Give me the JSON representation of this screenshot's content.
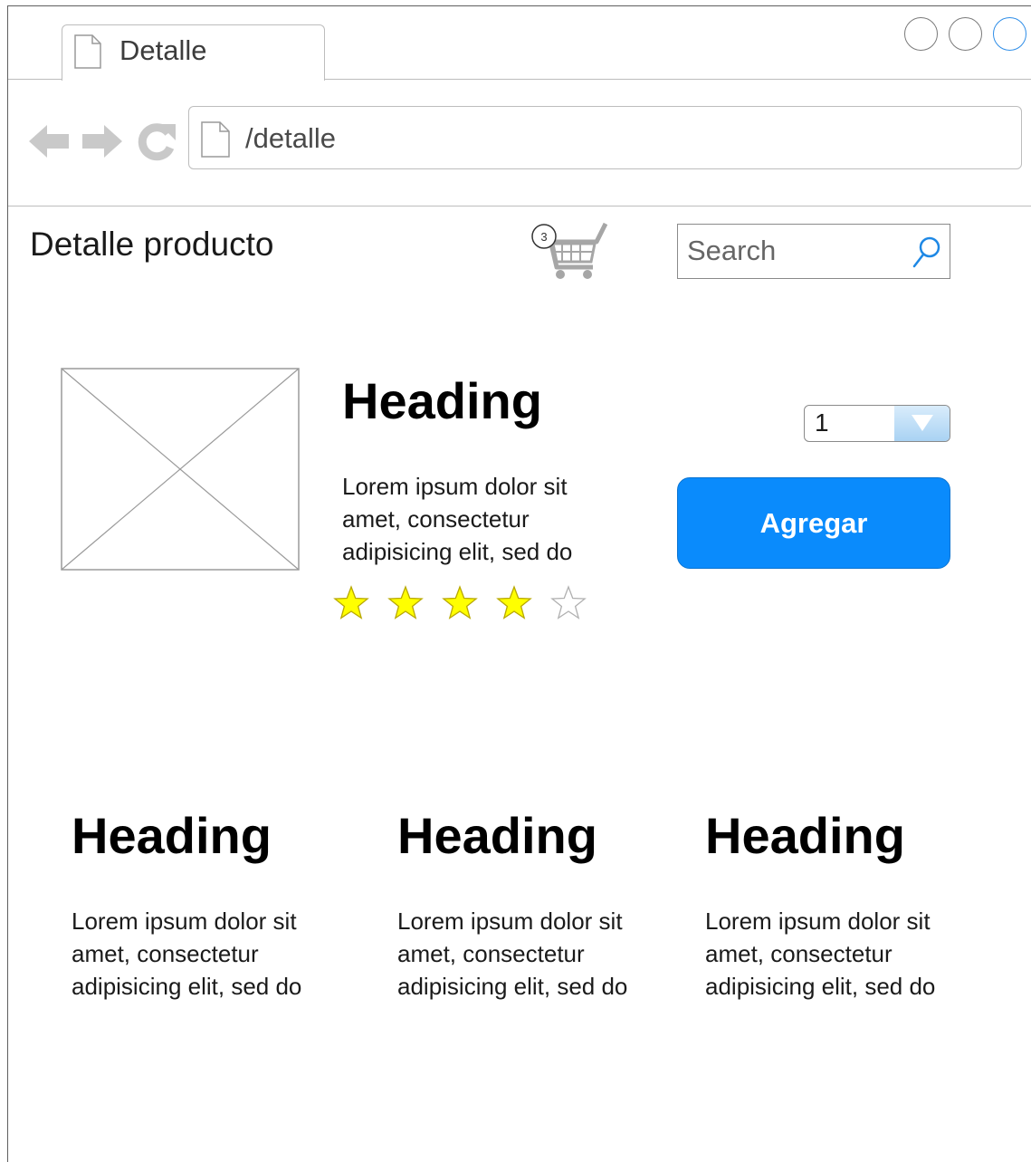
{
  "browser": {
    "tab_title": "Detalle",
    "url": "/detalle"
  },
  "header": {
    "title": "Detalle producto",
    "cart_count": "3",
    "search_placeholder": "Search"
  },
  "product": {
    "heading": "Heading",
    "description_lines": [
      "Lorem ipsum dolor sit",
      "amet, consectetur",
      "adipisicing elit, sed do"
    ],
    "rating": 4,
    "rating_max": 5,
    "quantity": "1",
    "add_button": "Agregar"
  },
  "features": [
    {
      "heading": "Heading",
      "lines": [
        "Lorem ipsum dolor sit",
        "amet, consectetur",
        "adipisicing elit, sed do"
      ]
    },
    {
      "heading": "Heading",
      "lines": [
        "Lorem ipsum dolor sit",
        "amet, consectetur",
        "adipisicing elit, sed do"
      ]
    },
    {
      "heading": "Heading",
      "lines": [
        "Lorem ipsum dolor sit",
        "amet, consectetur",
        "adipisicing elit, sed do"
      ]
    }
  ],
  "colors": {
    "accent": "#0a8bfc",
    "star_filled": "#ffff00",
    "star_outline": "#b0b0b0"
  },
  "icons": {
    "back": "back-arrow-icon",
    "forward": "forward-arrow-icon",
    "reload": "reload-icon",
    "cart": "cart-icon",
    "search": "search-icon",
    "page": "page-icon"
  }
}
